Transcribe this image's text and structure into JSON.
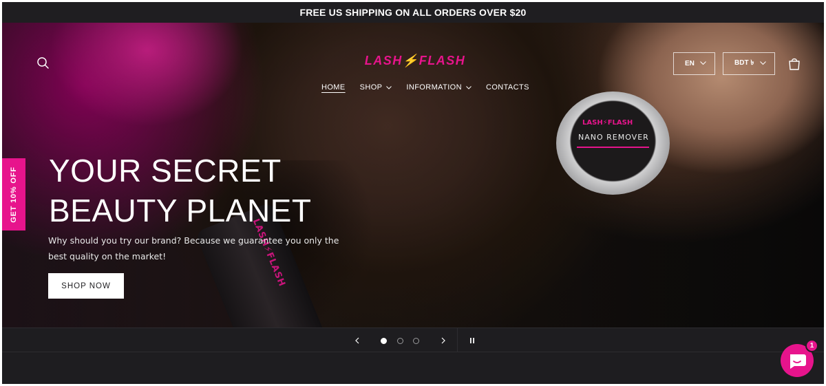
{
  "announcement": {
    "text": "FREE US SHIPPING ON ALL ORDERS OVER $20"
  },
  "header": {
    "logo_text": "LASH⚡FLASH",
    "nav": [
      {
        "label": "HOME",
        "active": true,
        "has_dropdown": false
      },
      {
        "label": "SHOP",
        "active": false,
        "has_dropdown": true
      },
      {
        "label": "INFORMATION",
        "active": false,
        "has_dropdown": true
      },
      {
        "label": "CONTACTS",
        "active": false,
        "has_dropdown": false
      }
    ],
    "language": {
      "selected": "EN"
    },
    "currency": {
      "selected": "BDT ৳"
    },
    "icons": {
      "search": "search-icon",
      "cart": "cart-icon"
    }
  },
  "hero": {
    "title_line1": "YOUR SECRET",
    "title_line2": "BEAUTY PLANET",
    "description": "Why should you try our brand? Because we guarantee you only the best quality on the market!",
    "cta_label": "SHOP NOW",
    "product_bottle_text": "LASH⚡FLASH",
    "product_jar_brand": "LASH⚡FLASH",
    "product_jar_name": "NANO REMOVER"
  },
  "promo_tab": {
    "label": "GET 10% OFF"
  },
  "slideshow": {
    "slide_count": 3,
    "active_slide": 1,
    "icons": {
      "prev": "chevron-left-icon",
      "next": "chevron-right-icon",
      "pause": "pause-icon"
    }
  },
  "chat": {
    "badge_count": "1",
    "icon": "chat-icon"
  },
  "colors": {
    "accent": "#e7148c",
    "background": "#1e1d20",
    "text": "#ffffff"
  }
}
